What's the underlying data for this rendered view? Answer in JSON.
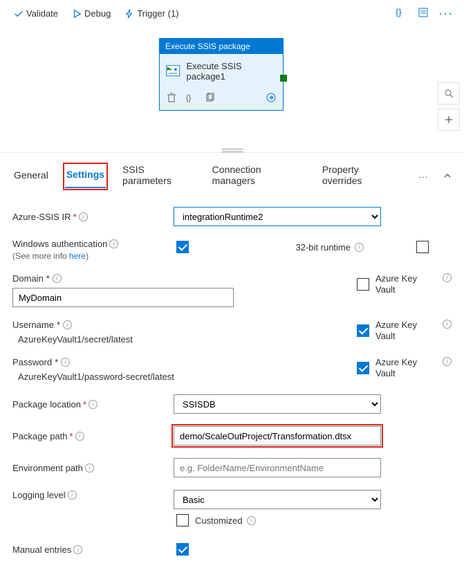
{
  "toolbar": {
    "validate": "Validate",
    "debug": "Debug",
    "trigger": "Trigger (1)"
  },
  "node": {
    "header": "Execute SSIS package",
    "title": "Execute SSIS package1"
  },
  "tabs": {
    "general": "General",
    "settings": "Settings",
    "ssis_params": "SSIS parameters",
    "conn_mgrs": "Connection managers",
    "prop_over": "Property overrides"
  },
  "form": {
    "azure_ssis_ir": {
      "label": "Azure-SSIS IR",
      "value": "integrationRuntime2"
    },
    "win_auth": {
      "label": "Windows authentication",
      "subtext_pre": "(See more info ",
      "subtext_link": "here",
      "subtext_post": ")"
    },
    "runtime32": {
      "label": "32-bit runtime"
    },
    "domain": {
      "label": "Domain",
      "value": "MyDomain"
    },
    "akv": "Azure Key Vault",
    "username": {
      "label": "Username",
      "value": "AzureKeyVault1/secret/latest"
    },
    "password": {
      "label": "Password",
      "value": "AzureKeyVault1/password-secret/latest"
    },
    "pkg_location": {
      "label": "Package location",
      "value": "SSISDB"
    },
    "pkg_path": {
      "label": "Package path",
      "value": "demo/ScaleOutProject/Transformation.dtsx"
    },
    "env_path": {
      "label": "Environment path",
      "placeholder": "e.g. FolderName/EnvironmentName"
    },
    "logging": {
      "label": "Logging level",
      "value": "Basic",
      "customized": "Customized"
    },
    "manual": {
      "label": "Manual entries"
    }
  }
}
